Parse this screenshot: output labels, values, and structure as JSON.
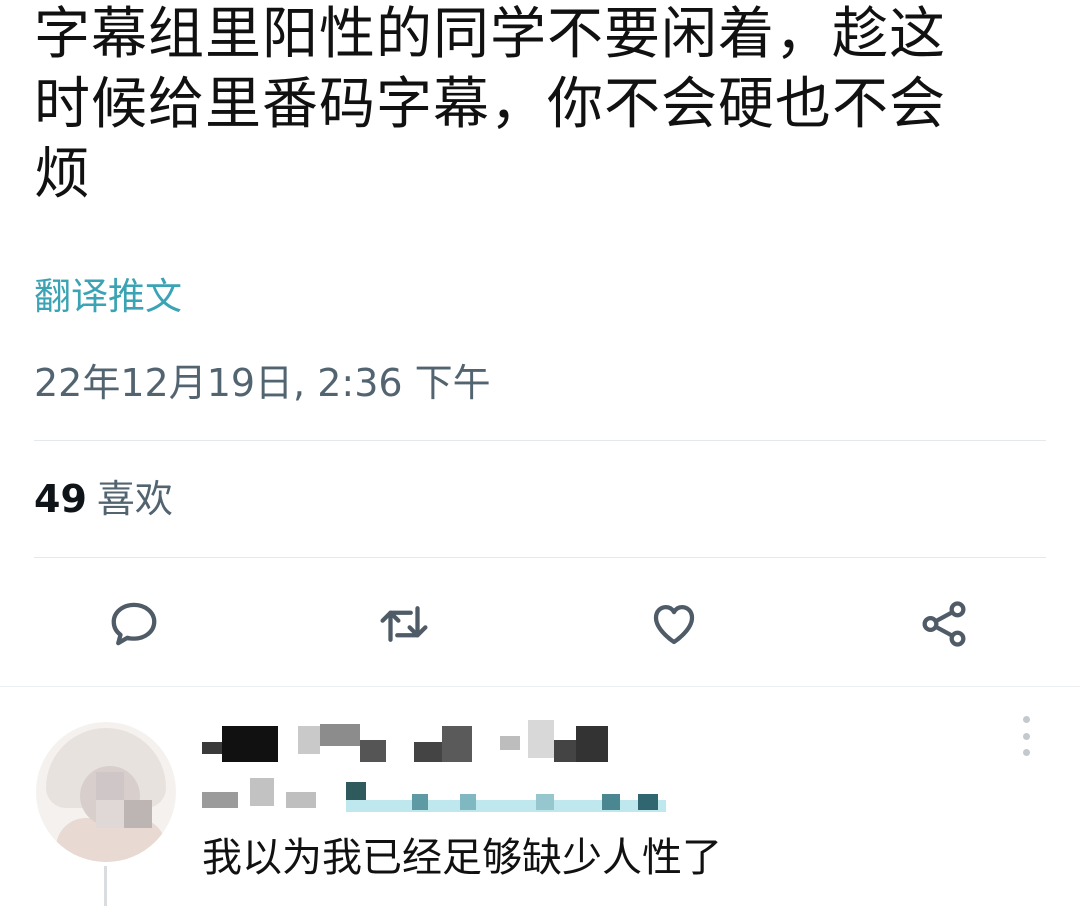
{
  "tweet": {
    "lines": [
      "字幕组里阳性的同学不要闲着，趁这",
      "时候给里番码字幕，你不会硬也不会",
      "烦"
    ],
    "translate_label": "翻译推文",
    "timestamp": "22年12月19日, 2:36 下午",
    "likes_count": "49",
    "likes_label": "喜欢"
  },
  "actions": [
    {
      "name": "reply",
      "icon": "reply-icon"
    },
    {
      "name": "retweet",
      "icon": "retweet-icon"
    },
    {
      "name": "like",
      "icon": "heart-icon"
    },
    {
      "name": "share",
      "icon": "share-icon"
    }
  ],
  "reply": {
    "text": "我以为我已经足够缺少人性了"
  },
  "colors": {
    "link": "#3aa3b4",
    "secondary_text": "#536471",
    "icon": "#536471",
    "divider": "#e6e9eb"
  }
}
